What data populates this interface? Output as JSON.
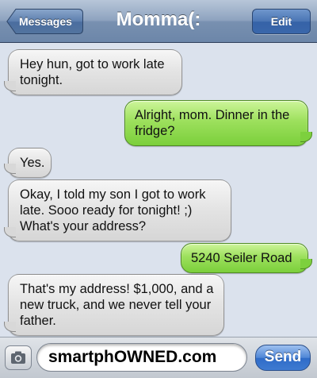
{
  "navbar": {
    "back_label": "Messages",
    "title": "Momma(:",
    "edit_label": "Edit"
  },
  "messages": [
    {
      "from": "them",
      "text": "Hey hun, got to work late tonight."
    },
    {
      "from": "me",
      "text": "Alright, mom. Dinner in the fridge?"
    },
    {
      "from": "them",
      "text": "Yes."
    },
    {
      "from": "them",
      "text": "Okay, I told my son I got to work late. Sooo ready for tonight! ;) What's your address?"
    },
    {
      "from": "me",
      "text": "5240 Seiler Road"
    },
    {
      "from": "them",
      "text": "That's my address! $1,000, and a new truck, and we never tell your father."
    }
  ],
  "composer": {
    "camera_icon": "camera-icon",
    "input_value": "smartphOWNED.com",
    "send_label": "Send"
  },
  "colors": {
    "nav_bar": "#7890b0",
    "thread_background": "#dbe2ed",
    "sent_bubble": "#8fd94e",
    "received_bubble": "#e3e3e3",
    "send_button": "#3e7ad1"
  }
}
